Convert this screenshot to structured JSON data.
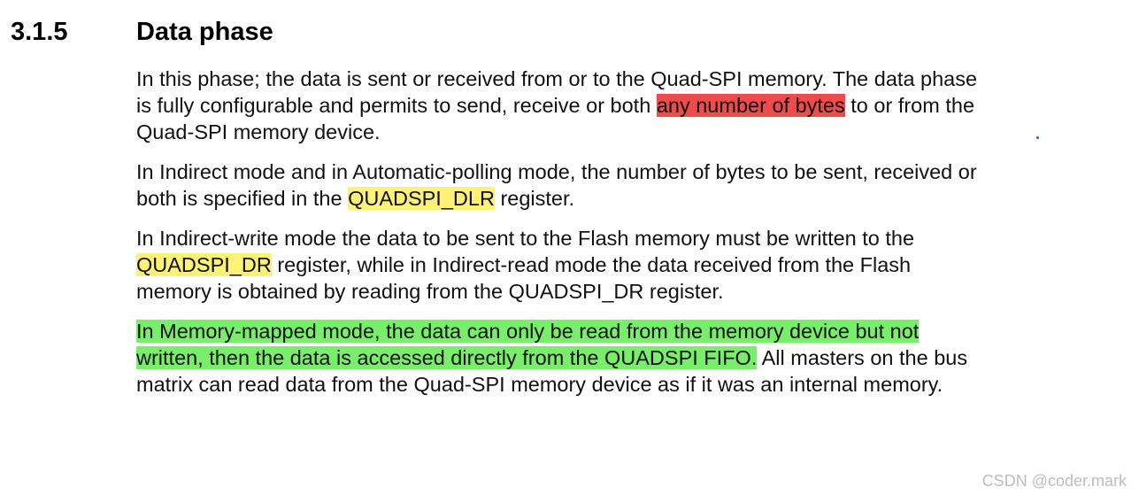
{
  "section": {
    "number": "3.1.5",
    "title": "Data phase"
  },
  "paragraphs": [
    {
      "lines": [
        [
          "In this phase; the data is sent or received from or to the Quad-SPI memory. The data phase"
        ],
        [
          "is fully configurable and permits to send, receive or both ",
          "any number of bytes",
          " to or from the"
        ],
        [
          "Quad-SPI memory device."
        ]
      ]
    },
    {
      "lines": [
        [
          "In Indirect mode and in Automatic-polling mode, the number of bytes to be sent, received or"
        ],
        [
          "both is specified in the ",
          "QUADSPI_DLR",
          " register."
        ]
      ]
    },
    {
      "lines": [
        [
          "In Indirect-write mode the data to be sent to the Flash memory must be written to the"
        ],
        [
          "QUADSPI_DR",
          " register, while in Indirect-read mode the data received from the Flash"
        ],
        [
          "memory is obtained by reading from the QUADSPI_DR register."
        ]
      ]
    },
    {
      "lines": [
        [
          "In Memory-mapped mode, the data can only be read from the memory device but not "
        ],
        [
          "written, then the data is accessed directly from the QUADSPI FIFO.",
          " All masters on the bus"
        ],
        [
          "matrix can read data from the Quad-SPI memory device as if it was an internal memory."
        ]
      ]
    }
  ],
  "highlight_colors": {
    "red": "#ee4b4b",
    "yellow": "#fff176",
    "green": "#78ee6a"
  },
  "watermark": "CSDN @coder.mark"
}
